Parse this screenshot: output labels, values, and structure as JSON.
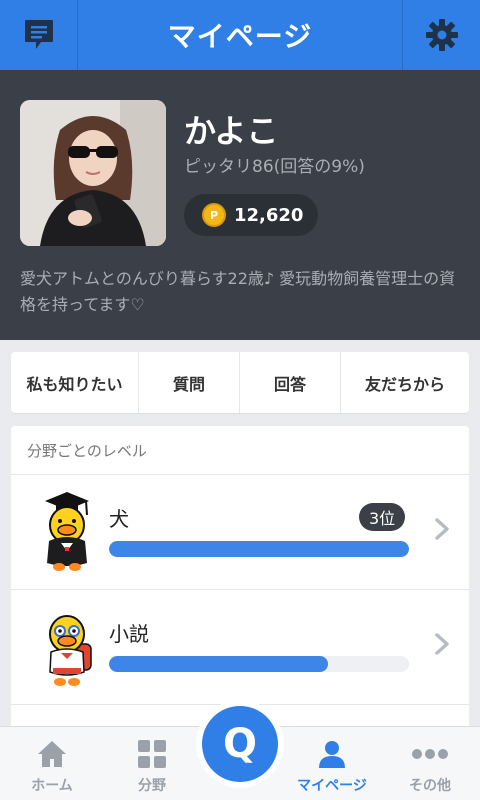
{
  "header": {
    "title": "マイページ",
    "left_icon": "message-icon",
    "right_icon": "gear-icon"
  },
  "profile": {
    "name": "かよこ",
    "match_text": "ピッタリ86(回答の9%)",
    "coins": "12,620",
    "coin_symbol": "P",
    "bio": "愛犬アトムとのんびり暮らす22歳♪ 愛玩動物飼養管理士の資格を持ってます♡"
  },
  "tabs": [
    {
      "label": "私も知りたい"
    },
    {
      "label": "質問"
    },
    {
      "label": "回答"
    },
    {
      "label": "友だちから"
    }
  ],
  "levels": {
    "section_title": "分野ごとのレベル",
    "items": [
      {
        "name": "犬",
        "rank": "3位",
        "progress": 1.0,
        "mascot": "graduate-chick"
      },
      {
        "name": "小説",
        "rank": "",
        "progress": 0.73,
        "mascot": "student-chick"
      }
    ]
  },
  "bottom_nav": [
    {
      "label": "ホーム",
      "icon": "home-icon"
    },
    {
      "label": "分野",
      "icon": "grid-icon"
    },
    {
      "label": "Q",
      "icon": "question-button"
    },
    {
      "label": "マイページ",
      "icon": "person-icon",
      "active": true
    },
    {
      "label": "その他",
      "icon": "more-icon"
    }
  ],
  "colors": {
    "accent": "#2f7fe6",
    "profile_bg": "#3a3f48",
    "progress": "#3d86e8",
    "coin": "#f3b71a"
  }
}
